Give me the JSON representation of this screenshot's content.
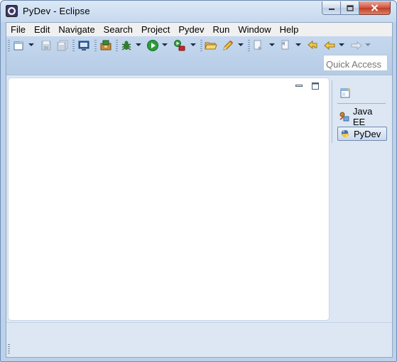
{
  "window": {
    "title": "PyDev - Eclipse"
  },
  "menu": [
    "File",
    "Edit",
    "Navigate",
    "Search",
    "Project",
    "Pydev",
    "Run",
    "Window",
    "Help"
  ],
  "toolbar": {
    "icons": [
      "new-wizard-icon",
      "save-icon",
      "save-all-icon",
      "print-icon",
      "open-type-icon",
      "debug-icon",
      "run-icon",
      "external-tools-icon",
      "open-folder-icon",
      "pencil-icon",
      "next-annotation-icon",
      "previous-annotation-icon",
      "last-edit-location-icon",
      "back-icon",
      "forward-icon"
    ]
  },
  "quick_access": {
    "placeholder": "Quick Access"
  },
  "perspectives": {
    "items": [
      {
        "label": "Java EE",
        "icon": "java-ee-icon",
        "active": false
      },
      {
        "label": "PyDev",
        "icon": "python-icon",
        "active": true
      }
    ]
  },
  "colors": {
    "accent": "#c5d8ee",
    "close_button": "#c23c24"
  }
}
